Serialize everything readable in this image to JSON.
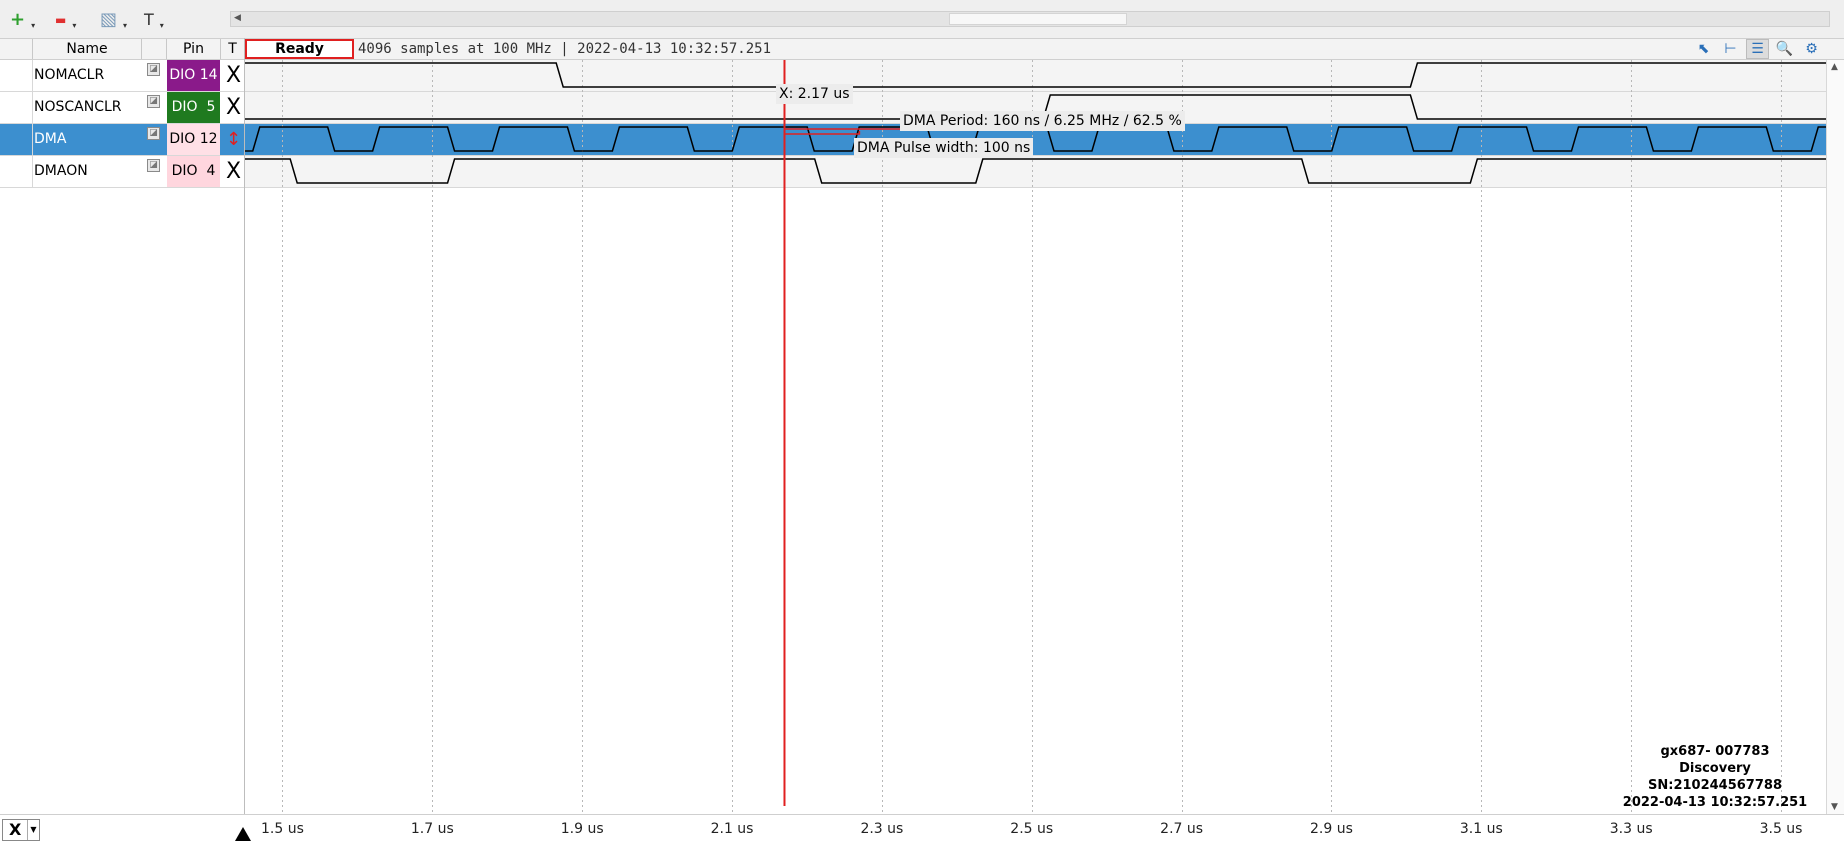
{
  "toolbar": {
    "buttons": [
      {
        "name": "add-signal",
        "glyph": "+",
        "color": "#2fa02f"
      },
      {
        "name": "remove-signal",
        "glyph": "▬",
        "color": "#e03030"
      },
      {
        "name": "edit",
        "glyph": "▧",
        "color": "#7a9ab8"
      },
      {
        "name": "text",
        "glyph": "T",
        "color": "#333333"
      }
    ]
  },
  "header": {
    "col_name": "Name",
    "col_pin": "Pin",
    "col_trigger": "T",
    "status": "Ready",
    "capture_info": "4096 samples at 100 MHz | 2022-04-13 10:32:57.251"
  },
  "signals": [
    {
      "name": "NOMACLR",
      "pin": "DIO 14",
      "pin_bg": "#8a1a8a",
      "pin_fg": "#ffffff",
      "trigger": "X"
    },
    {
      "name": "NOSCANCLR",
      "pin": "DIO  5",
      "pin_bg": "#1f7a1f",
      "pin_fg": "#ffffff",
      "trigger": "X"
    },
    {
      "name": "DMA",
      "pin": "DIO 12",
      "pin_bg": "#ffe0e6",
      "pin_fg": "#000000",
      "trigger": "↕",
      "selected": true
    },
    {
      "name": "DMAON",
      "pin": "DIO  4",
      "pin_bg": "#ffd6de",
      "pin_fg": "#000000",
      "trigger": "X"
    }
  ],
  "timeline": {
    "start_us": 1.45,
    "end_us": 3.56,
    "cursor_us": 2.17,
    "ticks": [
      "1.5 us",
      "1.7 us",
      "1.9 us",
      "2.1 us",
      "2.3 us",
      "2.5 us",
      "2.7 us",
      "2.9 us",
      "3.1 us",
      "3.3 us",
      "3.5 us"
    ],
    "tick_values_us": [
      1.5,
      1.7,
      1.9,
      2.1,
      2.3,
      2.5,
      2.7,
      2.9,
      3.1,
      3.3,
      3.5
    ]
  },
  "waveforms": {
    "NOMACLR": {
      "initial": 1,
      "edges_us": [
        1.87,
        3.01
      ]
    },
    "NOSCANCLR": {
      "initial": 0,
      "edges_us": [
        2.52,
        3.01
      ]
    },
    "DMA": {
      "initial": 0,
      "period_us": 0.16,
      "first_low_end_us": 1.465,
      "high_us": 0.1
    },
    "DMAON": {
      "initial": 1,
      "edges_us": [
        1.515,
        1.725,
        2.215,
        2.43,
        2.865,
        3.09
      ]
    }
  },
  "measurements": {
    "cursor_label": "X: 2.17 us",
    "period_label": "DMA Period: 160 ns / 6.25 MHz / 62.5 %",
    "pulse_label": "DMA Pulse width: 100 ns"
  },
  "device": {
    "line1": "gx687- 007783",
    "line2": "Discovery",
    "line3": "SN:210244567788",
    "line4": "2022-04-13 10:32:57.251"
  },
  "bottom": {
    "axis_select": "X"
  },
  "colors": {
    "selected_row": "#3c8fcf",
    "cursor": "#e02020",
    "waveform": "#000000"
  }
}
